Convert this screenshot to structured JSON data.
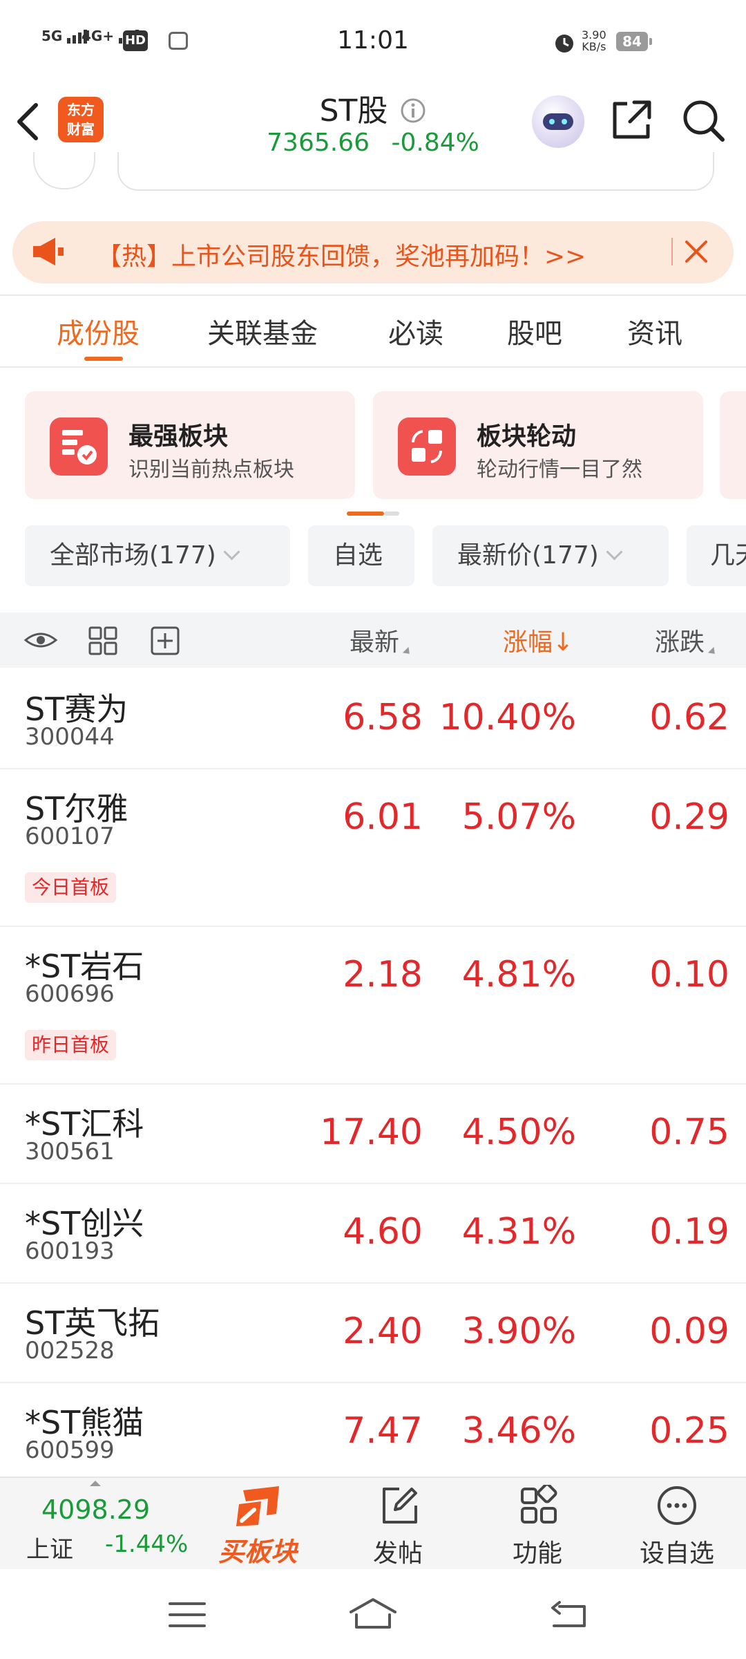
{
  "status_bar": {
    "time": "11:01",
    "signal_1": "5G",
    "signal_2": "4G+",
    "hd": "HD",
    "speed_value": "3.90",
    "speed_unit": "KB/s",
    "battery": "84"
  },
  "header": {
    "logo_line1": "东方",
    "logo_line2": "财富",
    "title": "ST股",
    "index_value": "7365.66",
    "index_change": "-0.84%"
  },
  "banner": {
    "text": "【热】上市公司股东回馈，奖池再加码！>>"
  },
  "tabs": [
    {
      "label": "成份股",
      "active": true
    },
    {
      "label": "关联基金"
    },
    {
      "label": "必读"
    },
    {
      "label": "股吧"
    },
    {
      "label": "资讯"
    }
  ],
  "cards": [
    {
      "title": "最强板块",
      "subtitle": "识别当前热点板块"
    },
    {
      "title": "板块轮动",
      "subtitle": "轮动行情一目了然"
    }
  ],
  "filters": [
    {
      "label": "全部市场(177)"
    },
    {
      "label": "自选"
    },
    {
      "label": "最新价(177)"
    },
    {
      "label": "几天"
    }
  ],
  "table": {
    "columns": [
      "最新",
      "涨幅↓",
      "涨跌"
    ],
    "rows": [
      {
        "name": "ST赛为",
        "code": "300044",
        "price": "6.58",
        "pct": "10.40%",
        "change": "0.62",
        "tag": ""
      },
      {
        "name": "ST尔雅",
        "code": "600107",
        "price": "6.01",
        "pct": "5.07%",
        "change": "0.29",
        "tag": "今日首板"
      },
      {
        "name": "*ST岩石",
        "code": "600696",
        "price": "2.18",
        "pct": "4.81%",
        "change": "0.10",
        "tag": "昨日首板"
      },
      {
        "name": "*ST汇科",
        "code": "300561",
        "price": "17.40",
        "pct": "4.50%",
        "change": "0.75",
        "tag": ""
      },
      {
        "name": "*ST创兴",
        "code": "600193",
        "price": "4.60",
        "pct": "4.31%",
        "change": "0.19",
        "tag": ""
      },
      {
        "name": "ST英飞拓",
        "code": "002528",
        "price": "2.40",
        "pct": "3.90%",
        "change": "0.09",
        "tag": ""
      },
      {
        "name": "*ST熊猫",
        "code": "600599",
        "price": "7.47",
        "pct": "3.46%",
        "change": "0.25",
        "tag": ""
      }
    ]
  },
  "bottom_bar": {
    "index_value": "4098.29",
    "index_name": "上证",
    "index_change": "-1.44%",
    "buy_label": "买板块",
    "post_label": "发帖",
    "func_label": "功能",
    "watch_label": "设自选"
  },
  "colors": {
    "accent": "#ef6a1f",
    "up": "#e2282a",
    "down": "#1a9b3a"
  }
}
